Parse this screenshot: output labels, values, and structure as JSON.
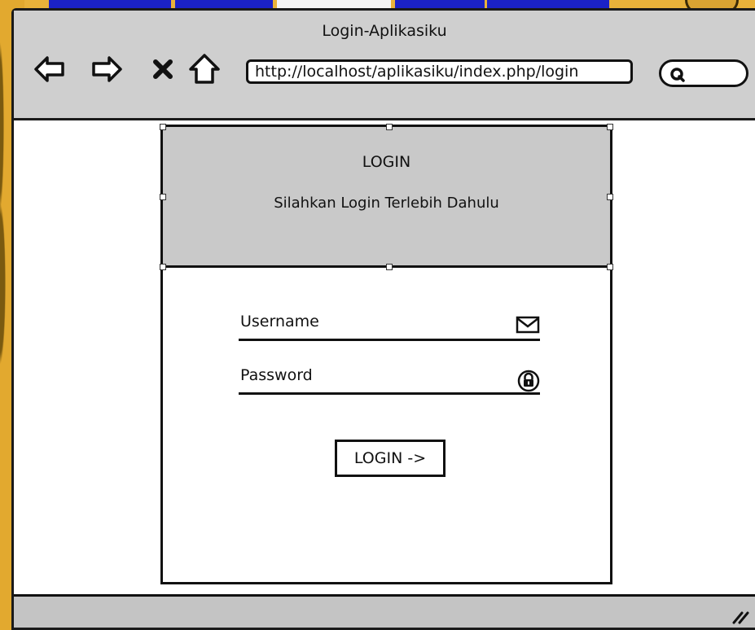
{
  "window": {
    "title": "Login-Aplikasiku",
    "url": "http://localhost/aplikasiku/index.php/login"
  },
  "toolbar": {
    "back_icon": "arrow-left-icon",
    "forward_icon": "arrow-right-icon",
    "stop_icon": "x-icon",
    "home_icon": "home-icon",
    "search_icon": "search-icon"
  },
  "login": {
    "heading": "LOGIN",
    "subtitle": "Silahkan Login Terlebih Dahulu",
    "username_label": "Username",
    "password_label": "Password",
    "button_label": "LOGIN ->"
  },
  "colors": {
    "header_gray": "#c9c9c9",
    "titlebar_gray": "#cfcfcf",
    "background_gold": "#e9b23a",
    "background_blue": "#1b22c7"
  }
}
